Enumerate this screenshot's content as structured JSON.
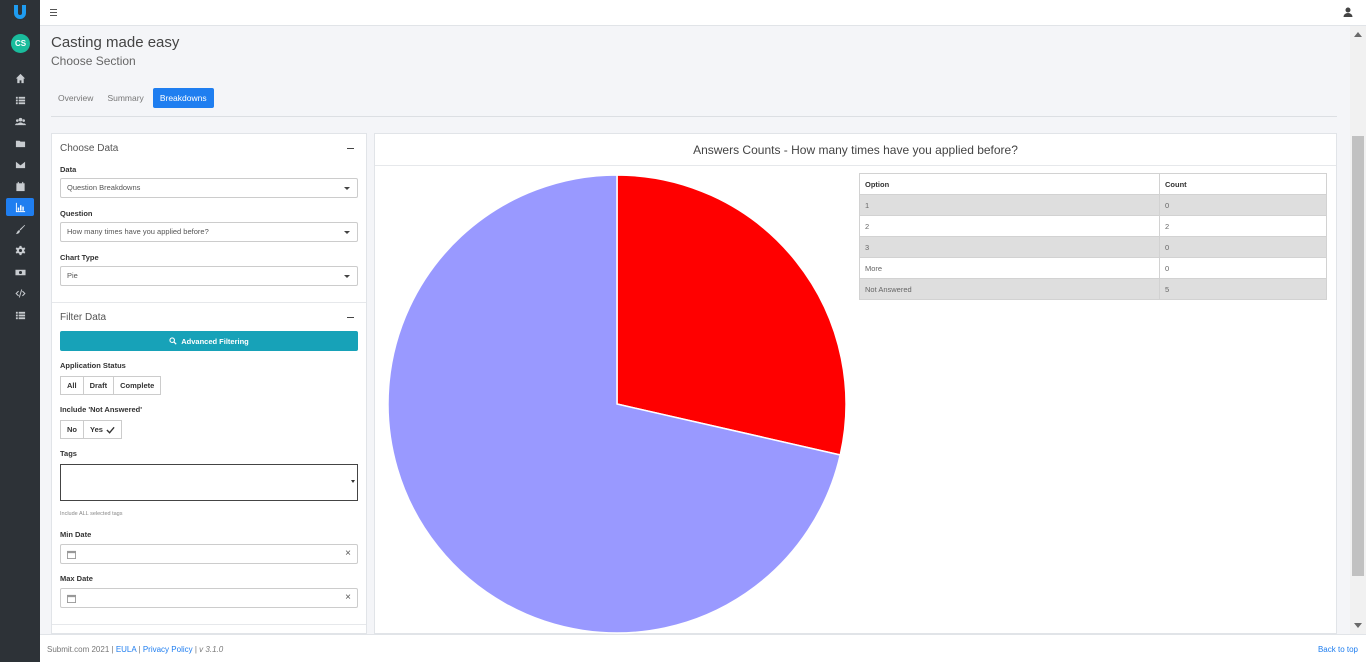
{
  "app": {
    "avatar_initials": "CS",
    "title": "Casting made easy",
    "subtitle": "Choose Section"
  },
  "tabs": [
    {
      "label": "Overview",
      "active": false
    },
    {
      "label": "Summary",
      "active": false
    },
    {
      "label": "Breakdowns",
      "active": true
    }
  ],
  "choose_data": {
    "heading": "Choose Data",
    "data_label": "Data",
    "data_value": "Question Breakdowns",
    "question_label": "Question",
    "question_value": "How many times have you applied before?",
    "chart_type_label": "Chart Type",
    "chart_type_value": "Pie"
  },
  "filter_data": {
    "heading": "Filter Data",
    "advanced_label": "Advanced Filtering",
    "status_label": "Application Status",
    "status_options": [
      "All",
      "Draft",
      "Complete"
    ],
    "not_answered_label": "Include 'Not Answered'",
    "not_answered_options": [
      "No",
      "Yes"
    ],
    "not_answered_selected": "Yes",
    "tags_label": "Tags",
    "tags_hint": "Include ALL selected tags",
    "min_date_label": "Min Date",
    "max_date_label": "Max Date",
    "clear_glyph": "×"
  },
  "chart_data": {
    "type": "pie",
    "title": "Answers Counts - How many times have you applied before?",
    "categories": [
      "1",
      "2",
      "3",
      "More",
      "Not Answered"
    ],
    "values": [
      0,
      2,
      0,
      0,
      5
    ],
    "colors": [
      "#3366cc",
      "#ff0000",
      "#ff9900",
      "#109618",
      "#9999ff"
    ],
    "table_headers": [
      "Option",
      "Count"
    ]
  },
  "footer": {
    "company": "Submit.com",
    "year": "2021",
    "sep": "|",
    "eula": "EULA",
    "privacy": "Privacy Policy",
    "version": "v 3.1.0",
    "back_to_top": "Back to top"
  },
  "colors": {
    "accent": "#1f7ef0",
    "teal": "#17a2b8",
    "rail": "#2d3237"
  }
}
